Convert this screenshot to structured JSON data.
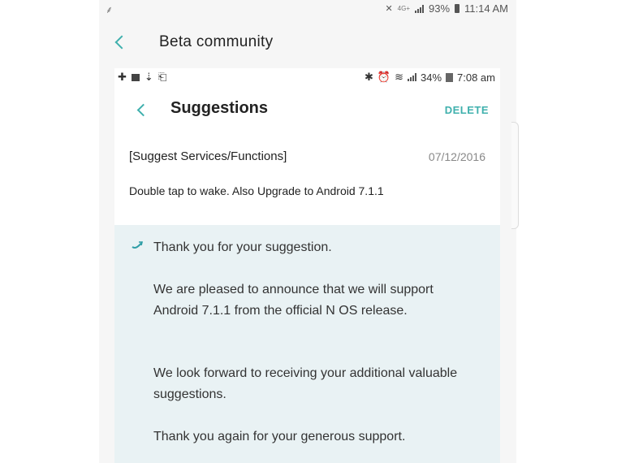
{
  "outer": {
    "status": {
      "left_glyph": "⸙",
      "network": "4G+",
      "battery_pct": "93%",
      "time": "11:14 AM"
    },
    "header": {
      "title": "Beta community"
    }
  },
  "inner": {
    "status": {
      "battery_pct": "34%",
      "time": "7:08 am"
    },
    "header": {
      "title": "Suggestions",
      "delete_label": "DELETE"
    },
    "post": {
      "category": "[Suggest Services/Functions]",
      "date": "07/12/2016",
      "body": "Double tap to wake. Also Upgrade to Android 7.1.1"
    },
    "reply": {
      "p1": "Thank you for your suggestion.",
      "p2": "We are pleased to announce that we will support Android 7.1.1 from the official N OS release.",
      "p3": "We look forward to receiving your additional valuable suggestions.",
      "p4": "Thank you again for your generous support."
    }
  },
  "colors": {
    "accent": "#3fb0ad",
    "reply_bg": "#e9f2f4"
  },
  "icons": [
    "back-arrow-icon",
    "signal-icon",
    "battery-icon",
    "reply-arrow-icon",
    "bluetooth-icon",
    "wifi-icon"
  ]
}
